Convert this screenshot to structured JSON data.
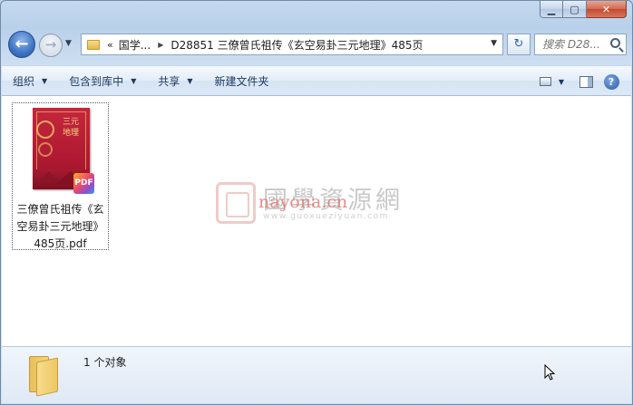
{
  "window": {
    "caption": {
      "minimize_glyph": "▁",
      "maximize_glyph": "▢",
      "close_glyph": "✕"
    }
  },
  "nav": {
    "back_glyph": "←",
    "forward_glyph": "→",
    "breadcrumb": {
      "overflow": "«",
      "item1": "国学...",
      "item2": "D28851 三僚曾氏祖传《玄空易卦三元地理》485页"
    },
    "refresh_glyph": "↻",
    "search_placeholder": "搜索 D28..."
  },
  "toolbar": {
    "organize": "组织",
    "include_in_library": "包含到库中",
    "share": "共享",
    "new_folder": "新建文件夹",
    "help_glyph": "?"
  },
  "files": [
    {
      "name": "三僚曾氏祖传《玄空易卦三元地理》485页.pdf",
      "label_line1": "三僚曾氏祖传《玄",
      "label_line2": "空易卦三元地理》",
      "label_line3": "485页.pdf",
      "thumb_title": "三元地理",
      "badge": "PDF"
    }
  ],
  "watermark": {
    "title": "國學資源網",
    "domain": "nayona.cn",
    "url": "www.guoxueziyuan.com"
  },
  "details": {
    "count": "1 个对象"
  },
  "colors": {
    "accent": "#3c74c4",
    "cover_red": "#b01a32",
    "watermark_red": "#e07a72"
  }
}
